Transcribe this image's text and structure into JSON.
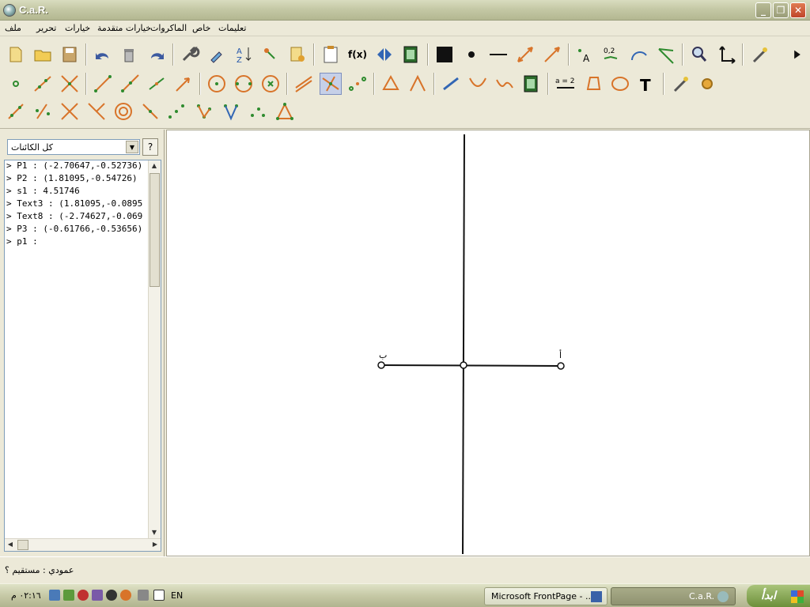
{
  "window": {
    "title": "C.a.R.",
    "minimize": "_",
    "maximize": "❐",
    "close": "✕"
  },
  "menu": {
    "items": [
      "ملف",
      "تحرير",
      "خيارات",
      "خيارات متقدمة",
      "الماكروات",
      "خاص",
      "تعليمات"
    ]
  },
  "toolbar": {
    "fx_label": "f(x)",
    "point_label_icon_text": "A",
    "decimal_label_text": "0,2",
    "a_eq_2_text": "a = 2",
    "text_tool_text": "T"
  },
  "object_panel": {
    "filter_value": "كل الكائنات",
    "help_label": "?",
    "objects": [
      "> P1 : (-2.70647,-0.52736)",
      "> P2 : (1.81095,-0.54726)",
      "> s1 : 4.51746",
      "> Text3 : (1.81095,-0.0895",
      "> Text8 : (-2.74627,-0.069",
      "> P3 : (-0.61766,-0.53656)",
      "> p1 :"
    ]
  },
  "canvas": {
    "label_left_point": "ب",
    "label_right_point": "أ"
  },
  "status": {
    "message": "عمودي : مستقيم ؟"
  },
  "taskbar": {
    "clock": "٠٢:١٦ م",
    "lang": "EN",
    "task_frontpage": "Microsoft FrontPage - ...",
    "task_car": "C.a.R.",
    "start_label": "ابدأ"
  },
  "colors": {
    "accent_green": "#2e8b2e",
    "accent_orange": "#d8742a",
    "accent_blue": "#3266b4",
    "canvas_bg": "#ffffff"
  }
}
